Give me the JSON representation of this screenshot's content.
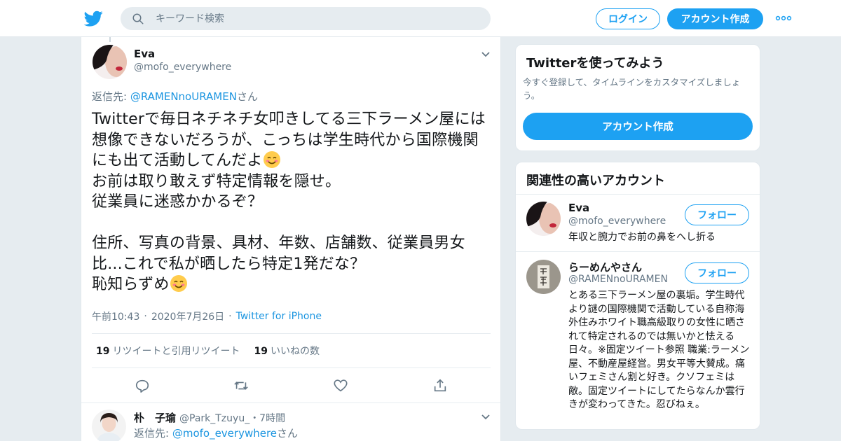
{
  "header": {
    "search_placeholder": "キーワード検索",
    "login_label": "ログイン",
    "signup_label": "アカウント作成"
  },
  "tweet": {
    "name": "Eva",
    "handle": "@mofo_everywhere",
    "reply_prefix": "返信先: ",
    "reply_target": "@RAMENnoURAMEN",
    "reply_suffix": "さん",
    "text_part1": "Twitterで毎日ネチネチ女叩きしてる三下ラーメン屋には想像できないだろうが、こっちは学生時代から国際機関にも出て活動してんだよ",
    "text_part2": "\nお前は取り敢えず特定情報を隠せ。\n従業員に迷惑かかるぞ？\n\n住所、写真の背景、具材、年数、店舗数、従業員男女比...これで私が晒したら特定1発だな？\n恥知らずめ",
    "time": "午前10:43",
    "date": "2020年7月26日",
    "source": "Twitter for iPhone",
    "retweet_count": "19",
    "retweet_label": "リツイートと引用リツイート",
    "like_count": "19",
    "like_label": "いいねの数"
  },
  "reply": {
    "name": "朴　子瑜",
    "handle": "@Park_Tzuyu_",
    "time": "・7時間",
    "reply_prefix": "返信先: ",
    "reply_target": "@mofo_everywhere",
    "reply_suffix": "さん"
  },
  "sidebar": {
    "try_title": "Twitterを使ってみよう",
    "try_desc": "今すぐ登録して、タイムラインをカスタマイズしましょう。",
    "try_button": "アカウント作成",
    "related_title": "関連性の高いアカウント",
    "accounts": [
      {
        "name": "Eva",
        "handle": "@mofo_everywhere",
        "follow_label": "フォロー",
        "bio": "年収と腕力でお前の鼻をへし折る"
      },
      {
        "name": "らーめんやさん",
        "handle": "@RAMENnoURAMEN",
        "follow_label": "フォロー",
        "bio": "とある三下ラーメン屋の裏垢。学生時代より謎の国際機関で活動している自称海外住みホワイト職高級取りの女性に晒されて特定されるのでは無いかと怯える日々。※固定ツイート参照 職業:ラーメン屋、不動産屋経営。男女平等大賛成。痛いフェミさん割と好き。クソフェミは敵。固定ツイートにしてたらなんか雲行きが変わってきた。忍びねぇ。"
      }
    ]
  },
  "colors": {
    "accent": "#1da1f2",
    "link": "#1b95e0",
    "secondary_text": "#657786",
    "background": "#e6ecf0"
  }
}
